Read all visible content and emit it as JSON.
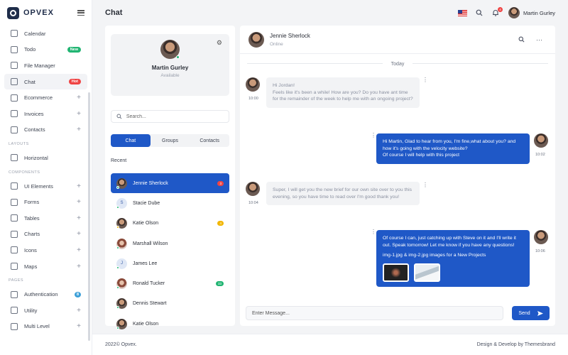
{
  "brand": {
    "name": "OPVEX"
  },
  "topbar": {
    "title": "Chat",
    "user_name": "Martin Gurley",
    "notification_count": "4"
  },
  "sidebar": {
    "items": [
      {
        "label": "Calendar",
        "icon": "calendar-icon"
      },
      {
        "label": "Todo",
        "icon": "checkbox-icon",
        "badge": "New"
      },
      {
        "label": "File Manager",
        "icon": "folder-icon"
      },
      {
        "label": "Chat",
        "icon": "chat-icon",
        "badge": "Hot"
      },
      {
        "label": "Ecommerce",
        "icon": "cart-icon",
        "expand": "+"
      },
      {
        "label": "Invoices",
        "icon": "invoice-icon",
        "expand": "+"
      },
      {
        "label": "Contacts",
        "icon": "contacts-icon",
        "expand": "+"
      }
    ],
    "section_layouts": "LAYOUTS",
    "layout_items": [
      {
        "label": "Horizontal",
        "icon": "horizontal-icon"
      }
    ],
    "section_components": "COMPONENTS",
    "component_items": [
      {
        "label": "UI Elements",
        "icon": "cube-icon",
        "expand": "+"
      },
      {
        "label": "Forms",
        "icon": "forms-icon",
        "expand": "+"
      },
      {
        "label": "Tables",
        "icon": "table-icon",
        "expand": "+"
      },
      {
        "label": "Charts",
        "icon": "chart-icon",
        "expand": "+"
      },
      {
        "label": "Icons",
        "icon": "icons-icon",
        "expand": "+"
      },
      {
        "label": "Maps",
        "icon": "map-icon",
        "expand": "+"
      }
    ],
    "section_pages": "PAGES",
    "page_items": [
      {
        "label": "Authentication",
        "icon": "lock-icon",
        "badge": "8"
      },
      {
        "label": "Utility",
        "icon": "utility-icon",
        "expand": "+"
      },
      {
        "label": "Multi Level",
        "icon": "share-icon",
        "expand": "+"
      }
    ]
  },
  "profile": {
    "name": "Martin Gurley",
    "status": "Available"
  },
  "search": {
    "placeholder": "Search..."
  },
  "tabs": [
    "Chat",
    "Groups",
    "Contacts"
  ],
  "recent_label": "Recent",
  "contacts": [
    {
      "name": "Jennie Sherlock",
      "badge": "3",
      "badge_color": "red",
      "dot": "#22b573",
      "avatar": "photo"
    },
    {
      "name": "Stacie Dube",
      "letter": "S",
      "dot": "#22b573",
      "avatar": "letter"
    },
    {
      "name": "Katie Olson",
      "badge": "4",
      "badge_color": "yellow",
      "dot": "#f2b705",
      "avatar": "photo"
    },
    {
      "name": "Marshall Wilson",
      "dot": "#22b573",
      "avatar": "female"
    },
    {
      "name": "James Lee",
      "letter": "J",
      "dot": "#22b573",
      "avatar": "letter"
    },
    {
      "name": "Ronald Tucker",
      "badge": "33",
      "badge_color": "green",
      "dot": "#22b573",
      "avatar": "female"
    },
    {
      "name": "Dennis Stewart",
      "dot": "#22b573",
      "avatar": "photo"
    },
    {
      "name": "Katie Olson",
      "dot": "#22b573",
      "avatar": "photo"
    }
  ],
  "chat": {
    "name": "Jennie Sherlock",
    "status": "Online",
    "divider": "Today",
    "messages": [
      {
        "text": "Hi Jordan!\nFeels like it's been a while! How are you? Do you have ant time for the remainder of the week to help me with an ongoing project?",
        "time": "10:00"
      },
      {
        "text": "Hi Martin, Glad to hear from you, I'm fine,what about you? and how it's going with the velocity website?\nOf course I will help with this project",
        "time": "10:02"
      },
      {
        "text": "Super, I will get you the new brief for our own site over to you this evening, so you have time to read over I'm good thank you!",
        "time": "10:04"
      },
      {
        "text": "Of course I can, just catching up with Steve on it and I'll write it out. Speak tomorrow! Let me know if you have any questions!",
        "attachment_text": "img-1.jpg & img-2.jpg images for a New Projects",
        "time": "10:06"
      }
    ]
  },
  "composer": {
    "placeholder": "Enter Message...",
    "send_label": "Send"
  },
  "footer": {
    "left": "2022© Opvex.",
    "right": "Design & Develop by Themesbrand"
  },
  "colors": {
    "primary": "#1f58c7",
    "online": "#22b573",
    "away": "#f2b705",
    "danger": "#ef4444"
  }
}
